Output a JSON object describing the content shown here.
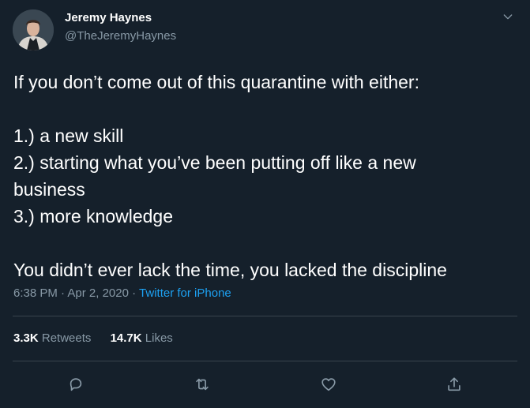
{
  "author": {
    "display_name": "Jeremy Haynes",
    "handle": "@TheJeremyHaynes"
  },
  "tweet": {
    "lines": [
      "If you don’t come out of this quarantine with either:",
      "",
      "1.) a new skill",
      "2.) starting what you’ve been putting off like a new",
      "business",
      "3.) more knowledge",
      "",
      "You didn’t ever lack the time, you lacked the discipline"
    ]
  },
  "meta": {
    "time": "6:38 PM",
    "separator": "·",
    "date": "Apr 2, 2020",
    "source": "Twitter for iPhone"
  },
  "stats": {
    "retweets_count": "3.3K",
    "retweets_label": "Retweets",
    "likes_count": "14.7K",
    "likes_label": "Likes"
  },
  "icons": {
    "caret": "chevron-down-icon",
    "reply": "reply-icon",
    "retweet": "retweet-icon",
    "like": "heart-icon",
    "share": "share-icon"
  },
  "colors": {
    "background": "#15202b",
    "text": "#ffffff",
    "secondary_text": "#8899a6",
    "link": "#1da1f2",
    "divider": "#38444d"
  }
}
